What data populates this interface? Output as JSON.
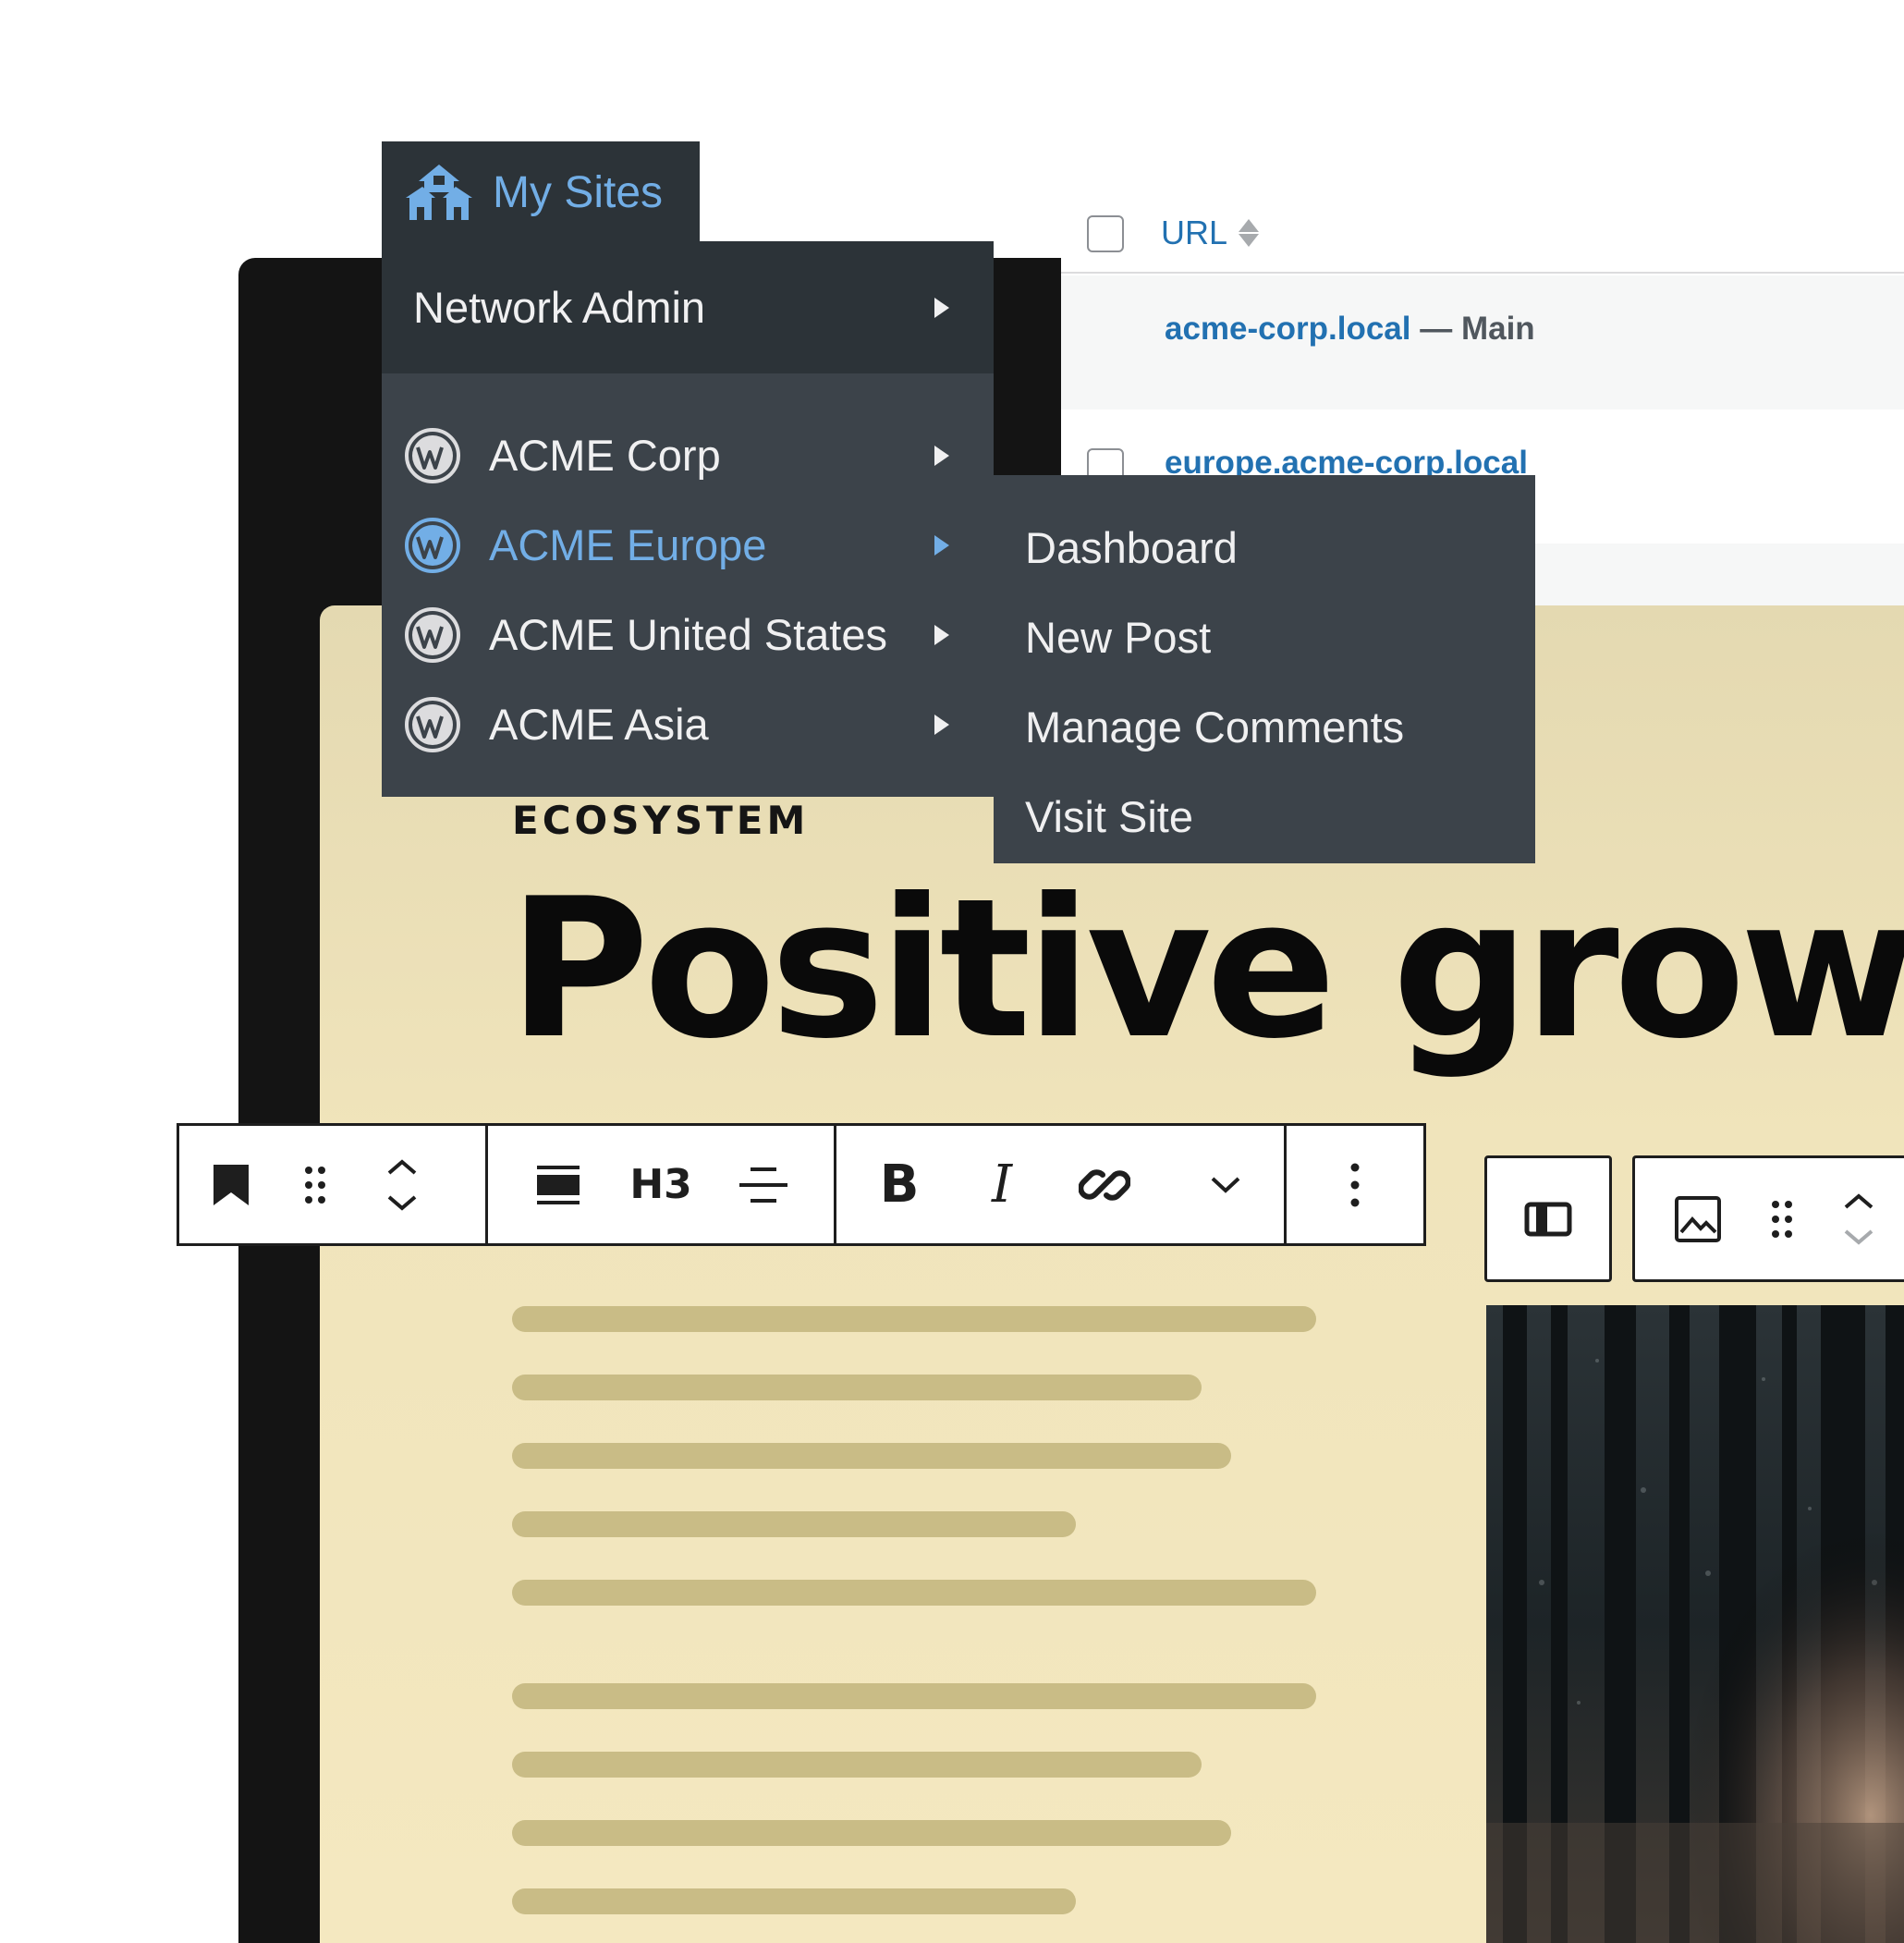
{
  "admin_bar": {
    "my_sites_label": "My Sites",
    "network_admin_label": "Network Admin",
    "sites": [
      {
        "label": "ACME Corp"
      },
      {
        "label": "ACME Europe"
      },
      {
        "label": "ACME United States"
      },
      {
        "label": "ACME Asia"
      }
    ],
    "submenu": [
      {
        "label": "Dashboard"
      },
      {
        "label": "New Post"
      },
      {
        "label": "Manage Comments"
      },
      {
        "label": "Visit Site"
      }
    ],
    "colors": {
      "bar": "#2c3338",
      "submenu": "#3c434a",
      "highlight": "#72aee6"
    }
  },
  "sites_table": {
    "column_url": "URL",
    "rows": [
      {
        "url": "acme-corp.local",
        "note": " — Main"
      },
      {
        "url": "europe.acme-corp.local",
        "note": ""
      }
    ]
  },
  "post": {
    "eyebrow": "ECOSYSTEM",
    "title": "Positive growth",
    "colors": {
      "background": "#f0e4bb",
      "placeholder_line": "#c9bc86"
    }
  },
  "block_toolbar": {
    "heading_level": "H3",
    "bold": "B",
    "italic": "I"
  }
}
